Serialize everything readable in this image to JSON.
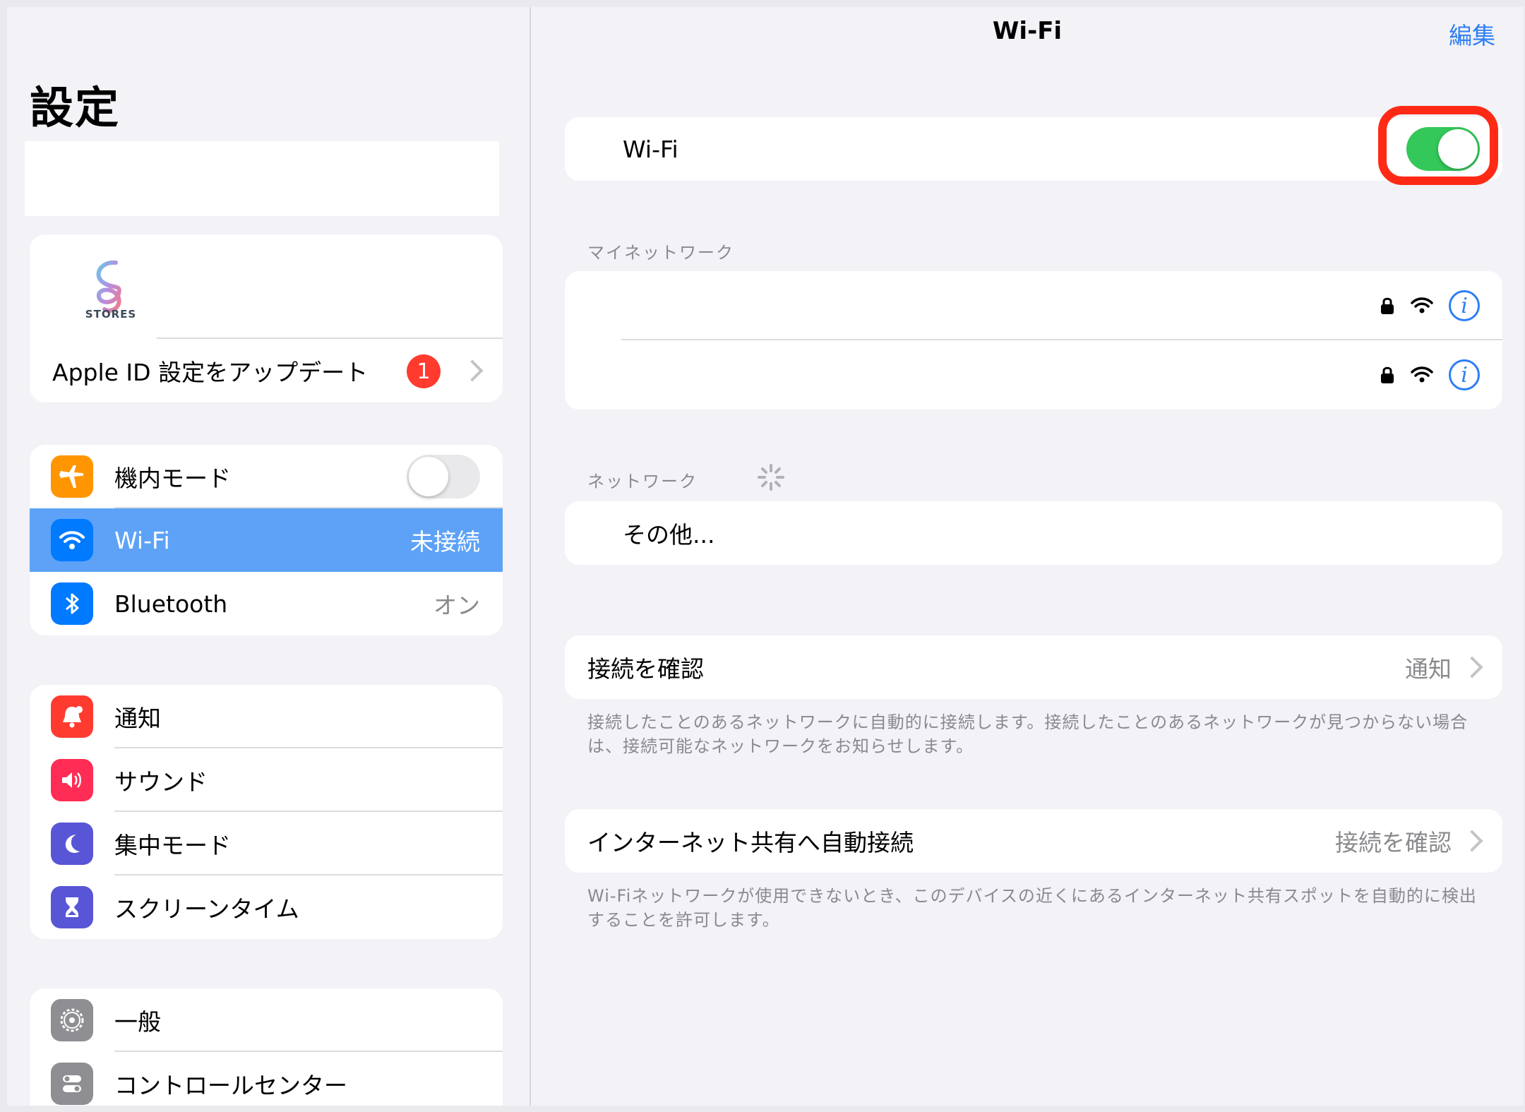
{
  "sidebar": {
    "title": "設定",
    "apple_card": {
      "logo_text": "STORES",
      "update_label": "Apple ID 設定をアップデート",
      "badge_count": "1"
    },
    "connectivity": [
      {
        "label": "機内モード",
        "icon": "airplane-icon",
        "color": "#ff9500",
        "toggle": false
      },
      {
        "label": "Wi-Fi",
        "icon": "wifi-icon",
        "color": "#007aff",
        "value": "未接続",
        "selected": true
      },
      {
        "label": "Bluetooth",
        "icon": "bluetooth-icon",
        "color": "#007aff",
        "value": "オン"
      }
    ],
    "notifications_group": [
      {
        "label": "通知",
        "icon": "notification-bell-icon",
        "color": "#ff3b30"
      },
      {
        "label": "サウンド",
        "icon": "speaker-icon",
        "color": "#ff2d55"
      },
      {
        "label": "集中モード",
        "icon": "moon-icon",
        "color": "#5856d6"
      },
      {
        "label": "スクリーンタイム",
        "icon": "hourglass-icon",
        "color": "#5856d6"
      }
    ],
    "general_group": [
      {
        "label": "一般",
        "icon": "gear-icon",
        "color": "#8e8e93"
      },
      {
        "label": "コントロールセンター",
        "icon": "control-center-icon",
        "color": "#8e8e93"
      }
    ]
  },
  "main": {
    "nav_title": "Wi-Fi",
    "edit_label": "編集",
    "wifi_row": {
      "label": "Wi-Fi",
      "toggle": true
    },
    "my_networks_header": "マイネットワーク",
    "networks_header": "ネットワーク",
    "other_label": "その他...",
    "ask_join": {
      "label": "接続を確認",
      "value": "通知"
    },
    "ask_join_note": "接続したことのあるネットワークに自動的に接続します。接続したことのあるネットワークが見つからない場合は、接続可能なネットワークをお知らせします。",
    "hotspot": {
      "label": "インターネット共有へ自動接続",
      "value": "接続を確認"
    },
    "hotspot_note": "Wi-Fiネットワークが使用できないとき、このデバイスの近くにあるインターネット共有スポットを自動的に検出することを許可します。",
    "highlight_color": "#ff2a16"
  }
}
